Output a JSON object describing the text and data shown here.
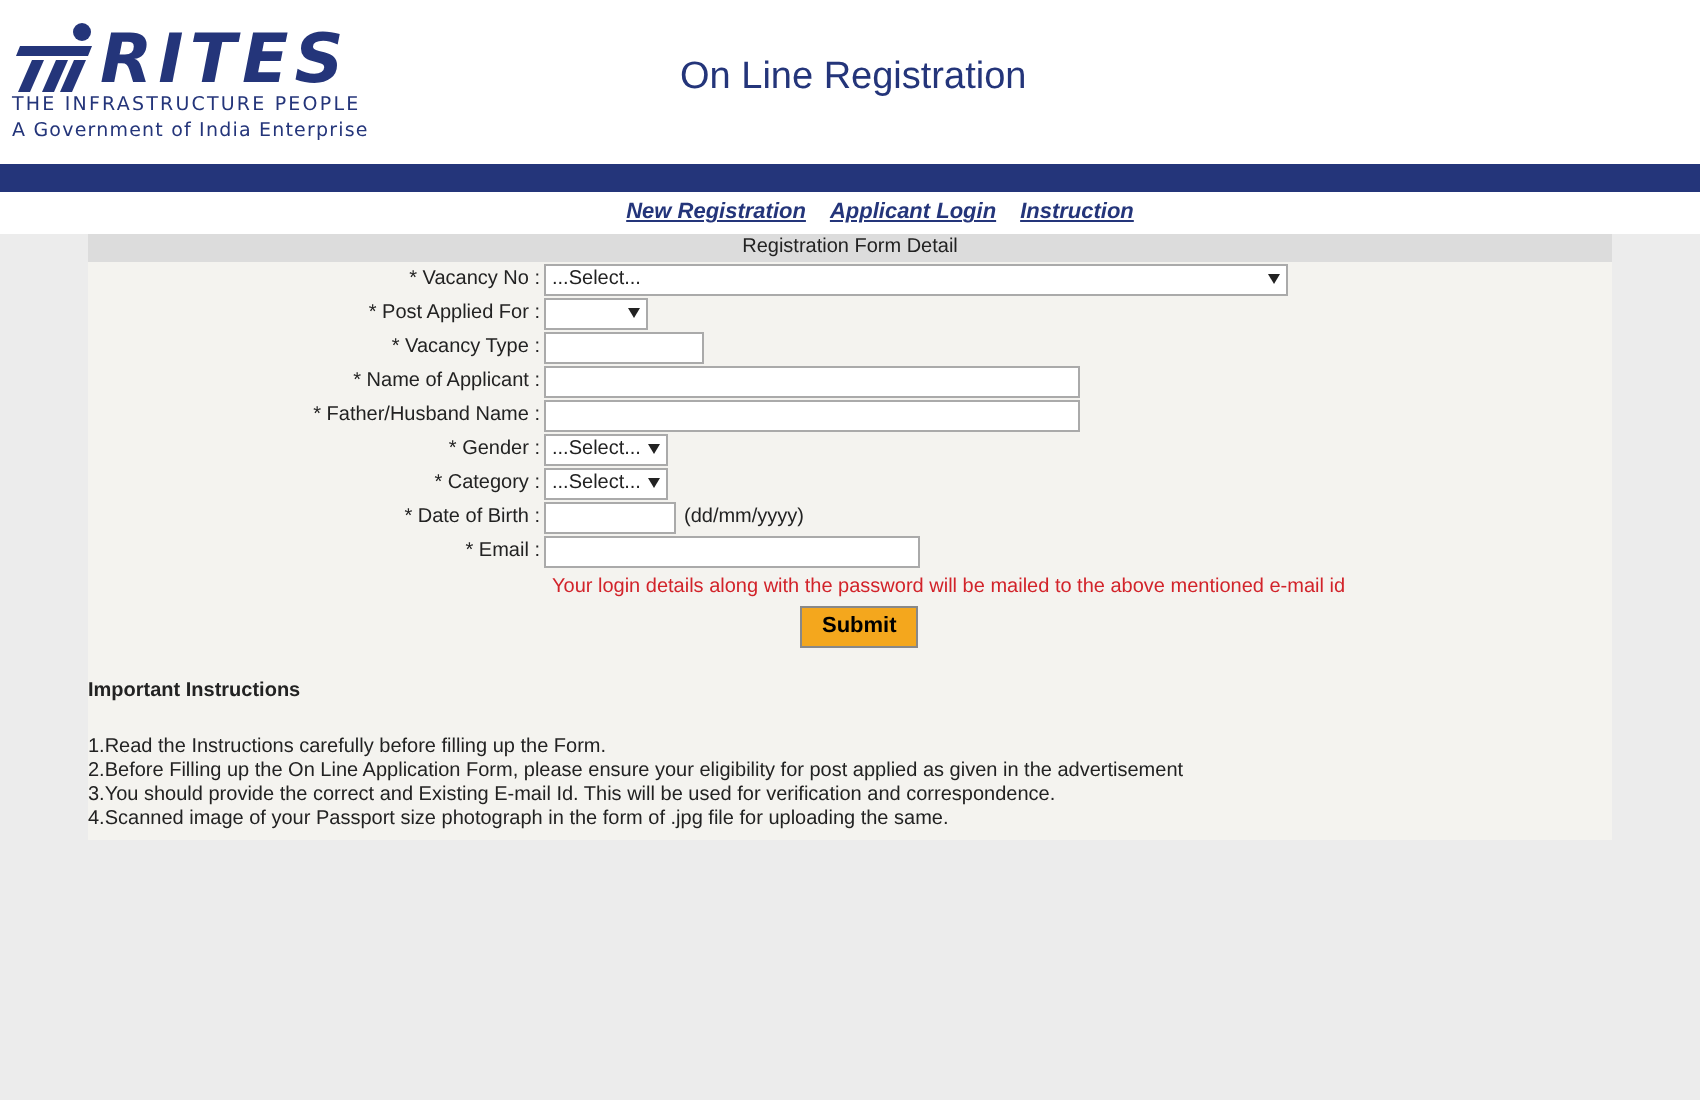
{
  "header": {
    "logo": "RITES",
    "tagline": "THE INFRASTRUCTURE PEOPLE",
    "subtitle": "A Government of India Enterprise",
    "title": "On Line Registration"
  },
  "nav": [
    "New Registration",
    "Applicant Login",
    "Instruction"
  ],
  "form": {
    "heading": "Registration Form Detail",
    "fields": [
      {
        "label": "* Vacancy No :",
        "kind": "select",
        "value": "...Select..."
      },
      {
        "label": "* Post Applied For :",
        "kind": "select"
      },
      {
        "label": "* Vacancy Type :",
        "kind": "text"
      },
      {
        "label": "* Name of Applicant :",
        "kind": "text"
      },
      {
        "label": "* Father/Husband Name :",
        "kind": "text"
      },
      {
        "label": "* Gender :",
        "kind": "select",
        "value": "...Select..."
      },
      {
        "label": "* Category :",
        "kind": "select",
        "value": "...Select..."
      },
      {
        "label": "* Date of Birth :",
        "kind": "text",
        "hint": "(dd/mm/yyyy)"
      },
      {
        "label": "* Email :",
        "kind": "text"
      }
    ],
    "note": "Your login details along with the password will be mailed to the above mentioned e-mail id",
    "submit": "Submit"
  },
  "instructions": {
    "title": "Important Instructions",
    "items": [
      "1.Read the Instructions carefully before filling up the Form.",
      "2.Before Filling up the On Line Application Form, please ensure your eligibility for post applied as given in the advertisement",
      "3.You should provide the correct and Existing E-mail Id. This will be used for verification and correspondence.",
      "4.Scanned image of your Passport size photograph in the form of .jpg file for uploading the same."
    ]
  }
}
